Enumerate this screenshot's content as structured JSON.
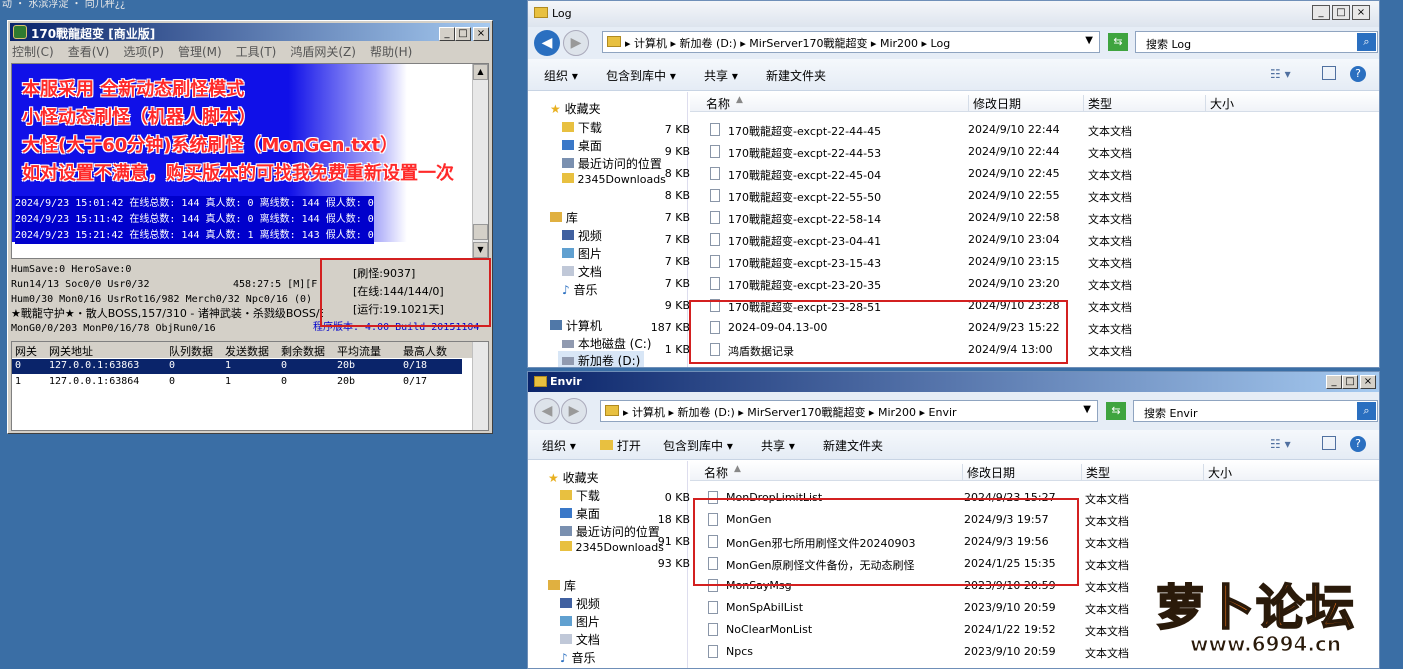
{
  "desktop": {
    "top_text": "动 ・ 水滨浮淀 ・ 向几秤¿¿"
  },
  "server": {
    "title": "170戰龍超变 [商业版]",
    "menu": [
      "控制(C)",
      "查看(V)",
      "选项(P)",
      "管理(M)",
      "工具(T)",
      "鸿盾网关(Z)",
      "帮助(H)"
    ],
    "overlay": [
      "本服采用 全新动态刷怪模式",
      "小怪动态刷怪（机器人脚本）",
      "大怪(大于60分钟)系统刷怪（MonGen.txt）",
      "如对设置不满意，购买版本的可找我免费重新设置一次"
    ],
    "logs": [
      "2024/9/23 15:01:42 在线总数: 144 真人数: 0 离线数: 144 假人数: 0",
      "2024/9/23 15:11:42 在线总数: 144 真人数: 0 离线数: 144 假人数: 0",
      "2024/9/23 15:21:42 在线总数: 144 真人数: 1 离线数: 143 假人数: 0"
    ],
    "status": {
      "l1": "HumSave:0 HeroSave:0",
      "l2": "Run14/13 Soc0/0 Usr0/32",
      "l2b": "458:27:5 [M][F",
      "l3": "Hum0/30 Mon0/16 UsrRot16/982 Merch0/32 Npc0/16 (0)",
      "l4": "★戰龍守护★・散人BOSS,157/310 - 诸神武装・杀戮级BOSS/309/2690",
      "l5": "MonG0/0/203 MonP0/16/78 ObjRun0/16",
      "version": "程序版本: 4.00 Build 20151104",
      "refresh": "[刷怪:9037]",
      "online": "[在线:144/144/0]",
      "uptime": "[运行:19.1021天]"
    },
    "table_headers": [
      "网关",
      "网关地址",
      "队列数据",
      "发送数据",
      "剩余数据",
      "平均流量",
      "最高人数"
    ],
    "table_rows": [
      [
        "0",
        "127.0.0.1:63863",
        "0",
        "1",
        "0",
        "20b",
        "0/18"
      ],
      [
        "1",
        "127.0.0.1:63864",
        "0",
        "1",
        "0",
        "20b",
        "0/17"
      ]
    ]
  },
  "log_window": {
    "title": "Log",
    "address": "▸ 计算机 ▸ 新加卷 (D:) ▸ MirServer170戰龍超变 ▸ Mir200 ▸ Log",
    "search": "搜索 Log",
    "toolbar": [
      "组织 ▾",
      "包含到库中 ▾",
      "共享 ▾",
      "新建文件夹"
    ],
    "nav": [
      "收藏夹",
      "下载",
      "桌面",
      "最近访问的位置",
      "2345Downloads",
      "库",
      "视频",
      "图片",
      "文档",
      "音乐",
      "计算机",
      "本地磁盘 (C:)",
      "新加卷 (D:)"
    ],
    "columns": [
      "名称",
      "修改日期",
      "类型",
      "大小"
    ],
    "files": [
      [
        "170戰龍超变-excpt-22-44-45",
        "2024/9/10 22:44",
        "文本文档",
        "7 KB"
      ],
      [
        "170戰龍超变-excpt-22-44-53",
        "2024/9/10 22:44",
        "文本文档",
        "9 KB"
      ],
      [
        "170戰龍超变-excpt-22-45-04",
        "2024/9/10 22:45",
        "文本文档",
        "8 KB"
      ],
      [
        "170戰龍超变-excpt-22-55-50",
        "2024/9/10 22:55",
        "文本文档",
        "8 KB"
      ],
      [
        "170戰龍超变-excpt-22-58-14",
        "2024/9/10 22:58",
        "文本文档",
        "7 KB"
      ],
      [
        "170戰龍超变-excpt-23-04-41",
        "2024/9/10 23:04",
        "文本文档",
        "7 KB"
      ],
      [
        "170戰龍超变-excpt-23-15-43",
        "2024/9/10 23:15",
        "文本文档",
        "7 KB"
      ],
      [
        "170戰龍超变-excpt-23-20-35",
        "2024/9/10 23:20",
        "文本文档",
        "7 KB"
      ],
      [
        "170戰龍超变-excpt-23-28-51",
        "2024/9/10 23:28",
        "文本文档",
        "9 KB"
      ],
      [
        "2024-09-04.13-00",
        "2024/9/23 15:22",
        "文本文档",
        "187 KB"
      ],
      [
        "鸿盾数据记录",
        "2024/9/4 13:00",
        "文本文档",
        "1 KB"
      ]
    ]
  },
  "envir_window": {
    "title": "Envir",
    "address": "▸ 计算机 ▸ 新加卷 (D:) ▸ MirServer170戰龍超变 ▸ Mir200 ▸ Envir",
    "search": "搜索 Envir",
    "toolbar": [
      "组织 ▾",
      "打开",
      "包含到库中 ▾",
      "共享 ▾",
      "新建文件夹"
    ],
    "nav": [
      "收藏夹",
      "下载",
      "桌面",
      "最近访问的位置",
      "2345Downloads",
      "库",
      "视频",
      "图片",
      "文档",
      "音乐"
    ],
    "columns": [
      "名称",
      "修改日期",
      "类型",
      "大小"
    ],
    "files": [
      [
        "MonDropLimitList",
        "2024/9/23 15:27",
        "文本文档",
        "0 KB"
      ],
      [
        "MonGen",
        "2024/9/3 19:57",
        "文本文档",
        "18 KB"
      ],
      [
        "MonGen邪七所用刷怪文件20240903",
        "2024/9/3 19:56",
        "文本文档",
        "91 KB"
      ],
      [
        "MonGen原刷怪文件备份，无动态刷怪",
        "2024/1/25 15:35",
        "文本文档",
        "93 KB"
      ],
      [
        "MonSayMsg",
        "2023/9/10 20:59",
        "文本文档",
        ""
      ],
      [
        "MonSpAbilList",
        "2023/9/10 20:59",
        "文本文档",
        ""
      ],
      [
        "NoClearMonList",
        "2024/1/22 19:52",
        "文本文档",
        ""
      ],
      [
        "Npcs",
        "2023/9/10 20:59",
        "文本文档",
        ""
      ]
    ]
  },
  "watermark": {
    "brand": "萝卜论坛",
    "url": "www.6994.cn"
  }
}
